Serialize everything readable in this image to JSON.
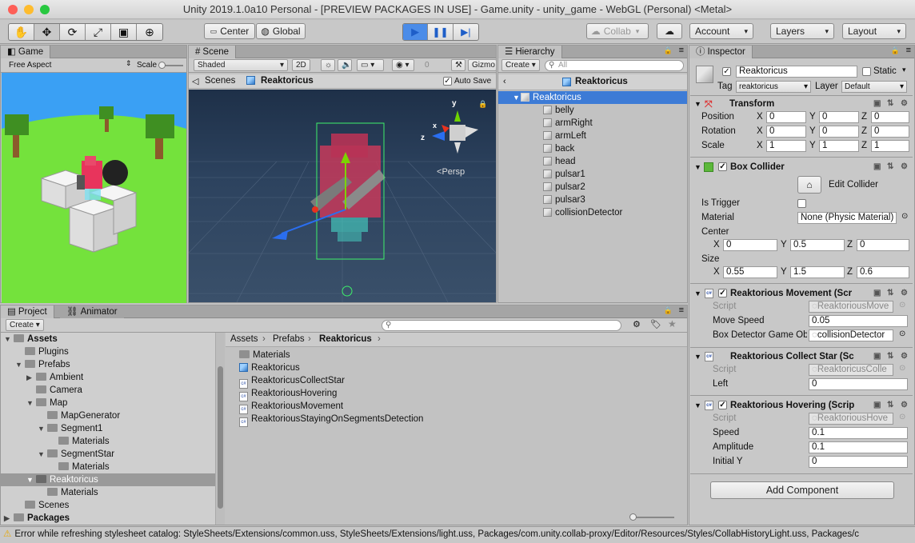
{
  "window_title": "Unity 2019.1.0a10 Personal - [PREVIEW PACKAGES IN USE] - Game.unity - unity_game - WebGL (Personal) <Metal>",
  "toolbar": {
    "center_label": "Center",
    "global_label": "Global",
    "collab_label": "Collab",
    "account_label": "Account",
    "layers_label": "Layers",
    "layout_label": "Layout"
  },
  "game": {
    "tab": "Game",
    "aspect": "Free Aspect",
    "scale_label": "Scale"
  },
  "scene": {
    "tab": "Scene",
    "shading": "Shaded",
    "mode_2d": "2D",
    "gizmos": "Gizmo",
    "count": "0",
    "breadcrumb_root": "Scenes",
    "breadcrumb_object": "Reaktoricus",
    "autosave_label": "Auto Save",
    "persp_label": "Persp",
    "axis_x": "x",
    "axis_y": "y",
    "axis_z": "z"
  },
  "hierarchy": {
    "tab": "Hierarchy",
    "create_label": "Create",
    "search_placeholder": "All",
    "header": "Reaktoricus",
    "root": "Reaktoricus",
    "children": [
      "belly",
      "armRight",
      "armLeft",
      "back",
      "head",
      "pulsar1",
      "pulsar2",
      "pulsar3",
      "collisionDetector"
    ]
  },
  "project": {
    "tab": "Project",
    "animator_tab": "Animator",
    "create_label": "Create",
    "tree": {
      "assets": "Assets",
      "plugins": "Plugins",
      "prefabs": "Prefabs",
      "ambient": "Ambient",
      "camera": "Camera",
      "map": "Map",
      "mapgenerator": "MapGenerator",
      "segment1": "Segment1",
      "segment1_materials": "Materials",
      "segmentstar": "SegmentStar",
      "segmentstar_materials": "Materials",
      "reaktoricus": "Reaktoricus",
      "reaktoricus_materials": "Materials",
      "scenes": "Scenes",
      "packages": "Packages"
    },
    "breadcrumb": [
      "Assets",
      "Prefabs",
      "Reaktoricus"
    ],
    "files": {
      "materials": "Materials",
      "reaktoricus": "Reaktoricus",
      "collectstar": "ReaktoricusCollectStar",
      "hovering": "ReaktoriousHovering",
      "movement": "ReaktoriousMovement",
      "staying": "ReaktoriousStayingOnSegmentsDetection"
    }
  },
  "inspector": {
    "tab": "Inspector",
    "object_name": "Reaktoricus",
    "static_label": "Static",
    "tag_label": "Tag",
    "tag_value": "reaktoricus",
    "layer_label": "Layer",
    "layer_value": "Default",
    "transform": {
      "title": "Transform",
      "position_label": "Position",
      "rotation_label": "Rotation",
      "scale_label": "Scale",
      "x": "X",
      "y": "Y",
      "z": "Z",
      "position": [
        "0",
        "0",
        "0"
      ],
      "rotation": [
        "0",
        "0",
        "0"
      ],
      "scale": [
        "1",
        "1",
        "1"
      ]
    },
    "box_collider": {
      "title": "Box Collider",
      "edit_label": "Edit Collider",
      "is_trigger_label": "Is Trigger",
      "material_label": "Material",
      "material_value": "None (Physic Material)",
      "center_label": "Center",
      "center": [
        "0",
        "0.5",
        "0"
      ],
      "size_label": "Size",
      "size": [
        "0.55",
        "1.5",
        "0.6"
      ]
    },
    "movement": {
      "title": "Reaktorious Movement (Scr",
      "script_label": "Script",
      "script_value": "ReaktoriousMove",
      "speed_label": "Move Speed",
      "speed_value": "0.05",
      "detector_label": "Box Detector Game Ob",
      "detector_value": "collisionDetector"
    },
    "collect": {
      "title": "Reaktorious Collect Star (Sc",
      "script_label": "Script",
      "script_value": "ReaktoricusColle",
      "left_label": "Left",
      "left_value": "0"
    },
    "hovering": {
      "title": "Reaktorious Hovering (Scrip",
      "script_label": "Script",
      "script_value": "ReaktoriousHove",
      "speed_label": "Speed",
      "speed_value": "0.1",
      "amplitude_label": "Amplitude",
      "amplitude_value": "0.1",
      "initial_label": "Initial Y",
      "initial_value": "0"
    },
    "add_component_label": "Add Component"
  },
  "status_bar": "Error while refreshing stylesheet catalog: StyleSheets/Extensions/common.uss, StyleSheets/Extensions/light.uss, Packages/com.unity.collab-proxy/Editor/Resources/Styles/CollabHistoryLight.uss, Packages/c",
  "colors": {
    "selection": "#3d7bd6",
    "sky": "#3a9df0",
    "grass": "#73e03a",
    "scene_bg": "#283a52"
  }
}
